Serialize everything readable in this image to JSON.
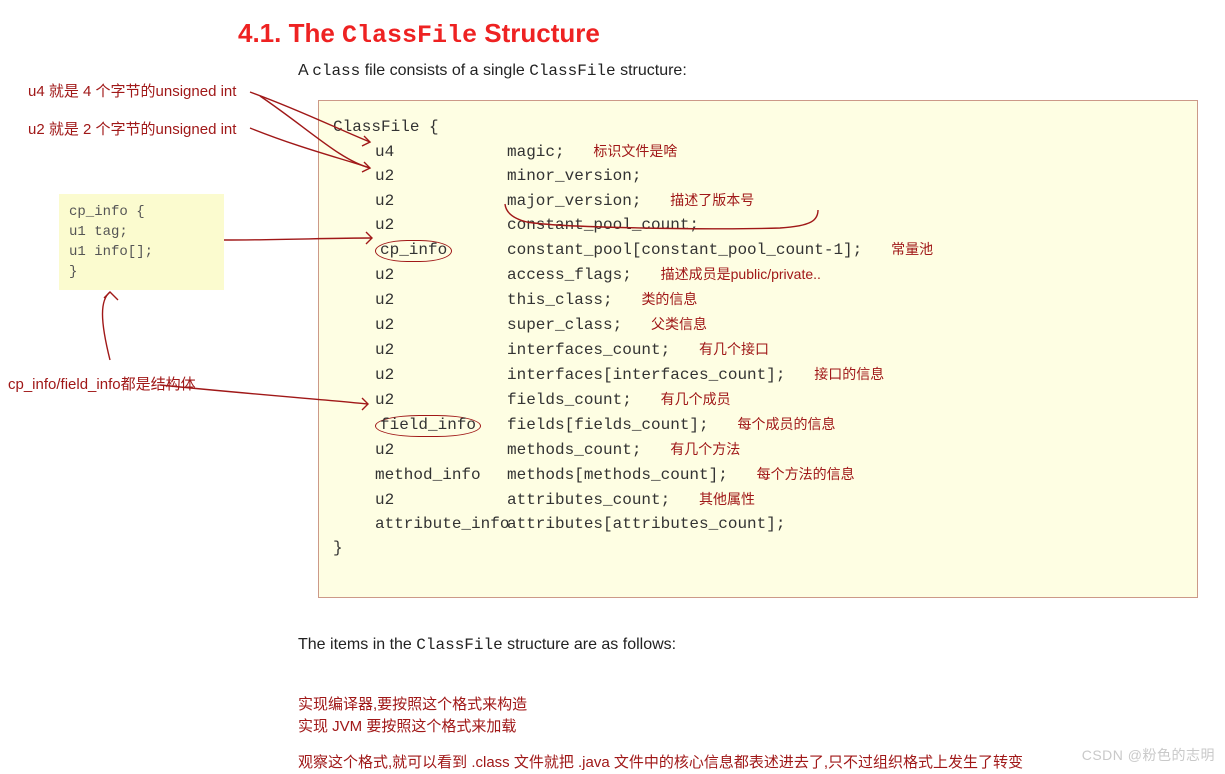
{
  "heading": {
    "number": "4.1. The ",
    "classfile": "ClassFile",
    "structure": " Structure"
  },
  "intro": {
    "p1": "A ",
    "c1": "class",
    "p2": " file consists of a single ",
    "c2": "ClassFile",
    "p3": " structure:"
  },
  "code": {
    "open": "ClassFile {",
    "close": "}",
    "lines": [
      {
        "type": "u4",
        "name": "magic;",
        "note": "标识文件是啥"
      },
      {
        "type": "u2",
        "name": "minor_version;",
        "note": ""
      },
      {
        "type": "u2",
        "name": "major_version;",
        "note": "描述了版本号"
      },
      {
        "type": "u2",
        "name": "constant_pool_count;",
        "note": ""
      },
      {
        "type": "cp_info",
        "name": "constant_pool[constant_pool_count-1];",
        "note": "常量池"
      },
      {
        "type": "u2",
        "name": "access_flags;",
        "note": "描述成员是public/private.."
      },
      {
        "type": "u2",
        "name": "this_class;",
        "note": "类的信息"
      },
      {
        "type": "u2",
        "name": "super_class;",
        "note": "父类信息"
      },
      {
        "type": "u2",
        "name": "interfaces_count;",
        "note": "有几个接口"
      },
      {
        "type": "u2",
        "name": "interfaces[interfaces_count];",
        "note": "接口的信息"
      },
      {
        "type": "u2",
        "name": "fields_count;",
        "note": "有几个成员"
      },
      {
        "type": "field_info",
        "name": "fields[fields_count];",
        "note": "每个成员的信息"
      },
      {
        "type": "u2",
        "name": "methods_count;",
        "note": "有几个方法"
      },
      {
        "type": "method_info",
        "name": "methods[methods_count];",
        "note": "每个方法的信息"
      },
      {
        "type": "u2",
        "name": "attributes_count;",
        "note": "其他属性"
      },
      {
        "type": "attribute_info",
        "name": "attributes[attributes_count];",
        "note": ""
      }
    ]
  },
  "outro": {
    "p1": "The items in the ",
    "c1": "ClassFile",
    "p2": " structure are as follows:"
  },
  "left": {
    "u4": "u4 就是 4 个字节的unsigned int",
    "u2": "u2 就是 2 个字节的unsigned int",
    "struct": "cp_info/field_info都是结构体"
  },
  "cpinfo": {
    "l1": "cp_info {",
    "l2": "    u1 tag;",
    "l3": "    u1 info[];",
    "l4": "}"
  },
  "bottom": {
    "l1": "实现编译器,要按照这个格式来构造",
    "l2": "实现 JVM 要按照这个格式来加载",
    "l3": "观察这个格式,就可以看到 .class 文件就把 .java 文件中的核心信息都表述进去了,只不过组织格式上发生了转变"
  },
  "watermark": "CSDN @粉色的志明"
}
